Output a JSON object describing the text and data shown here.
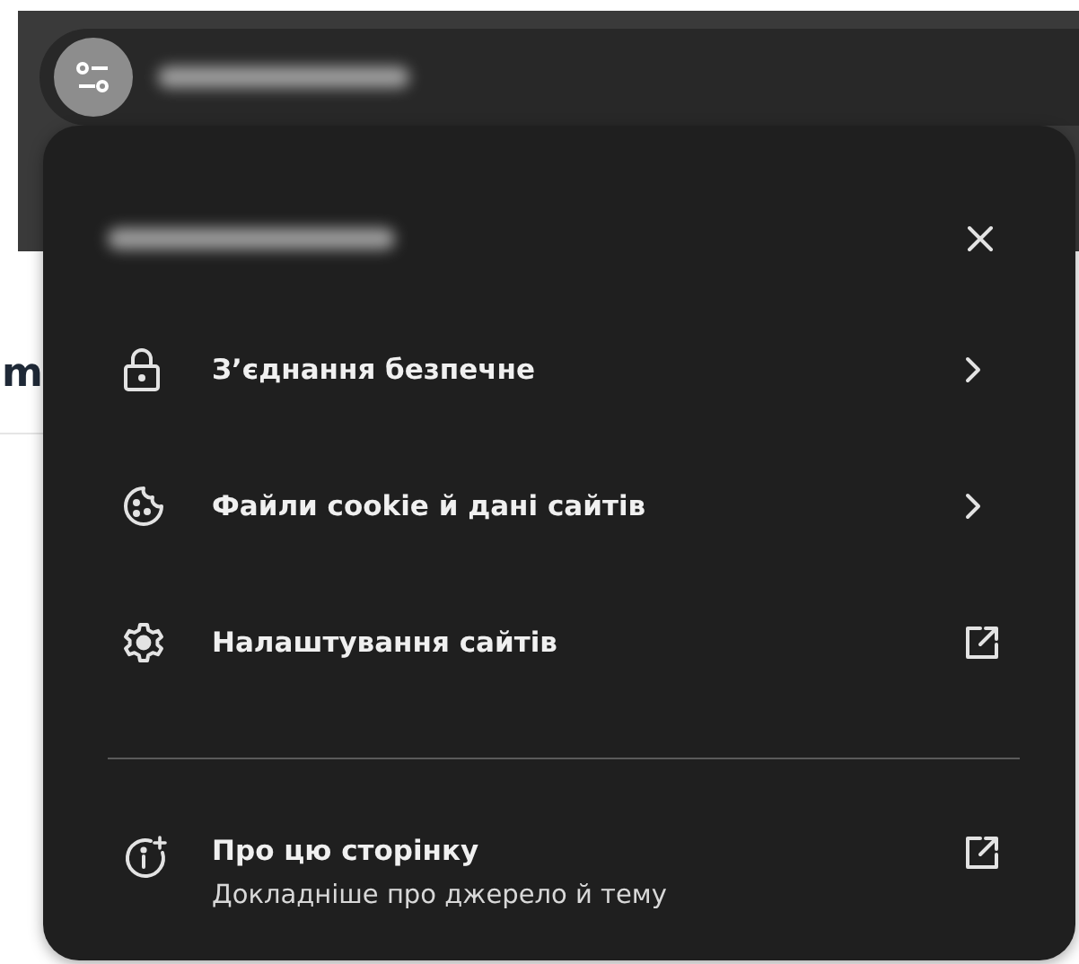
{
  "page_heading_fragment": "m",
  "popup": {
    "items": [
      {
        "kind": "submenu",
        "label": "З’єднання безпечне"
      },
      {
        "kind": "submenu",
        "label": "Файли cookie й дані сайтів"
      },
      {
        "kind": "external",
        "label": "Налаштування сайтів"
      },
      {
        "kind": "divider"
      },
      {
        "kind": "external",
        "label": "Про цю сторінку",
        "description": "Докладніше про джерело й тему"
      }
    ]
  }
}
